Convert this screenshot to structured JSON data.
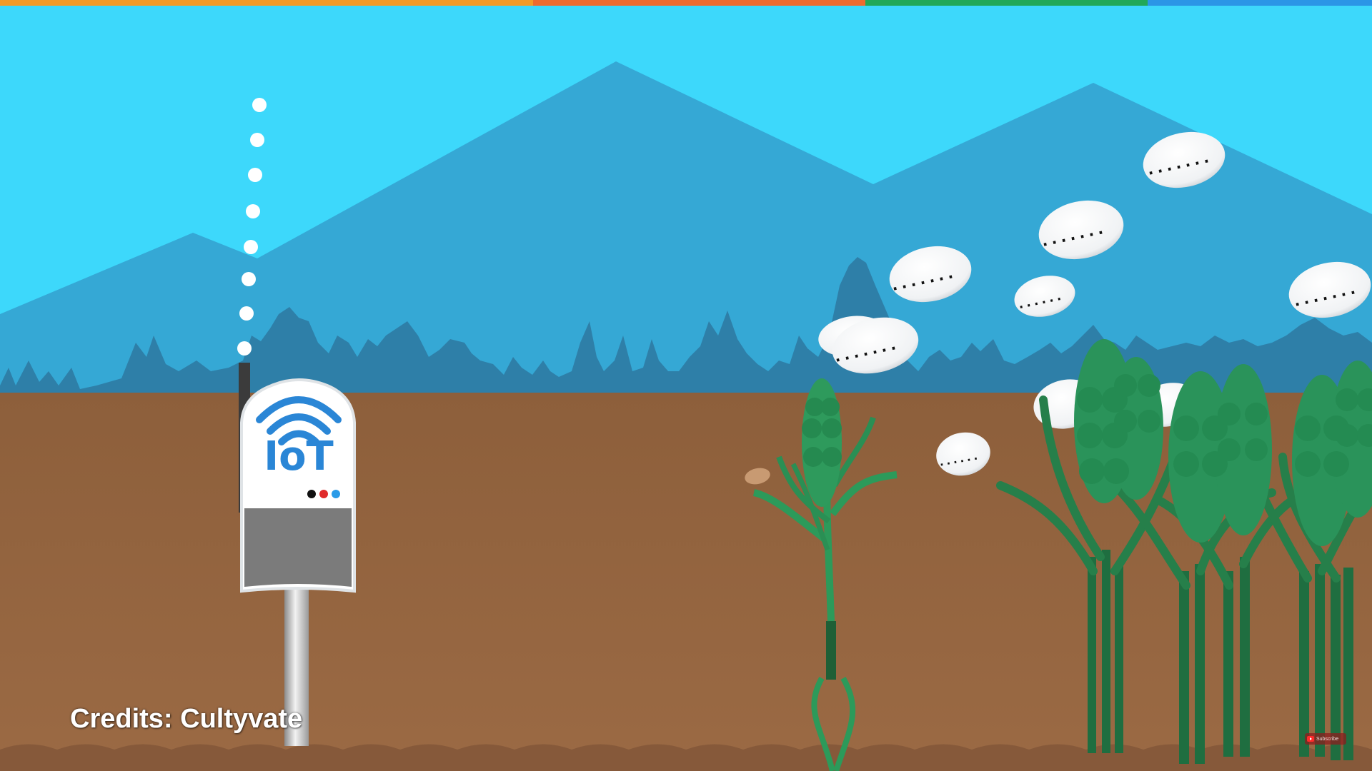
{
  "scene": {
    "credits": "Credits: Cultyvate",
    "iot_label": "IoT",
    "bubble_text": ".......",
    "small_bubble_text": "......",
    "subscribe_label": "Subscribe",
    "icons": [
      "iot-sensor-device-icon",
      "wifi-signal-icon",
      "youtube-subscribe-icon",
      "wheat-plant-icon"
    ]
  },
  "colors": {
    "sky": "#3dd8fb",
    "mountain": "#35a8d5",
    "tree_line": "#2e7fa8",
    "soil": "#93643f",
    "soil_dark": "#855a37",
    "plant_green": "#2c9a5a",
    "plant_dark": "#1e6e3f",
    "bubble": "#f4f6f8",
    "wifi_blue": "#2a86d6",
    "top_bar": [
      "#f39a27",
      "#ef6a2e",
      "#21a857",
      "#2b96e6"
    ]
  }
}
